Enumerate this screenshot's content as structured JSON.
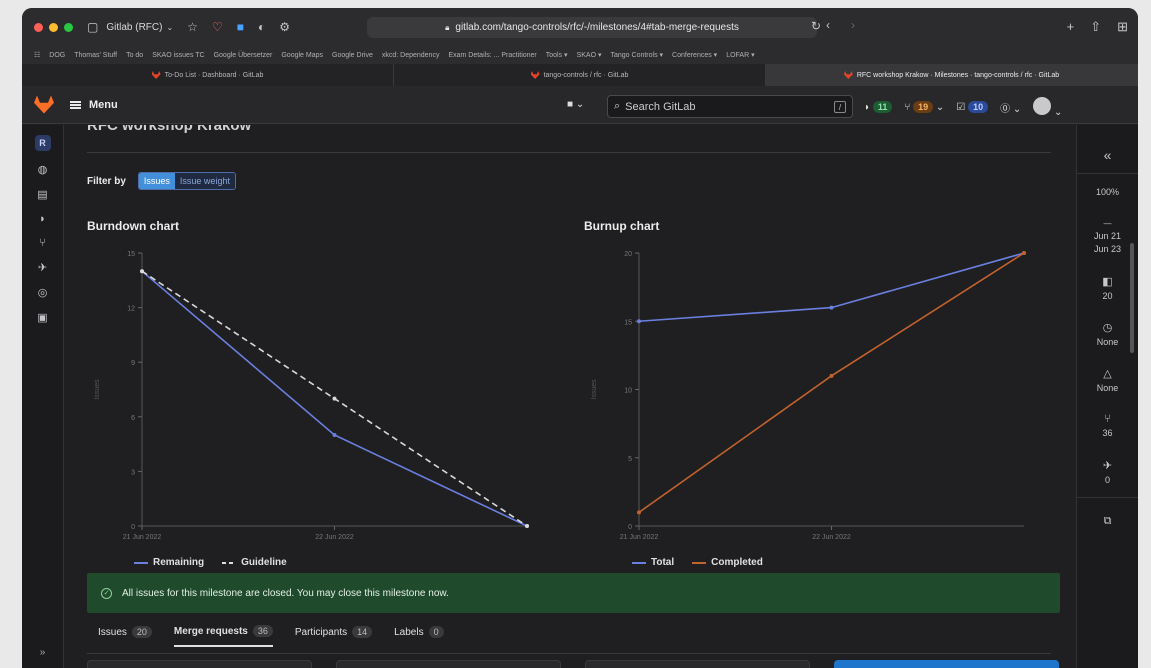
{
  "browser": {
    "tab_group": "Gitlab (RFC)",
    "url": "gitlab.com/tango-controls/rfc/-/milestones/4#tab-merge-requests",
    "bookmarks": [
      "DOG",
      "Thomas' Stuff",
      "To do",
      "SKAO issues TC",
      "Google Übersetzer",
      "Google Maps",
      "Google Drive",
      "xkcd: Dependency",
      "Exam Details: ... Practitioner",
      "Tools ▾",
      "SKAO ▾",
      "Tango Controls ▾",
      "Conferences ▾",
      "LOFAR ▾"
    ],
    "tabs": [
      {
        "label": "To-Do List · Dashboard · GitLab",
        "active": false
      },
      {
        "label": "tango-controls / rfc · GitLab",
        "active": false
      },
      {
        "label": "RFC workshop Krakow · Milestones · tango-controls / rfc · GitLab",
        "active": true
      }
    ]
  },
  "header": {
    "menu_label": "Menu",
    "search_placeholder": "Search GitLab",
    "search_shortcut": "/",
    "issues_count": "11",
    "mr_count": "19",
    "todo_count": "10"
  },
  "sidebar": {
    "project_letter": "R"
  },
  "main": {
    "title": "RFC workshop Krakow",
    "filter_label": "Filter by",
    "filter_options": [
      "Issues",
      "Issue weight"
    ],
    "burndown_title": "Burndown chart",
    "burnup_title": "Burnup chart",
    "alert": "All issues for this milestone are closed. You may close this milestone now.",
    "tabs": [
      {
        "label": "Issues",
        "count": "20"
      },
      {
        "label": "Merge requests",
        "count": "36"
      },
      {
        "label": "Participants",
        "count": "14"
      },
      {
        "label": "Labels",
        "count": "0"
      }
    ]
  },
  "right_sidebar": {
    "zoom": "100%",
    "start": "Jun 21",
    "end": "Jun 23",
    "issues": "20",
    "time": "None",
    "weight": "None",
    "mrs": "36",
    "releases": "0"
  },
  "colors": {
    "blue": "#6b7fe0",
    "orange": "#c4622d",
    "guideline": "#d9d9d9",
    "alert_bg": "#1f4a2c"
  },
  "chart_data": [
    {
      "type": "line",
      "title": "Burndown chart",
      "x": [
        "21 Jun 2022",
        "22 Jun 2022",
        "23 Jun 2022"
      ],
      "x_tick_labels": [
        "21 Jun 2022",
        "22 Jun 2022"
      ],
      "ylim": [
        0,
        15
      ],
      "yticks": [
        0,
        3,
        6,
        9,
        12,
        15
      ],
      "ylabel": "Issues",
      "series": [
        {
          "name": "Remaining",
          "values": [
            14,
            5,
            0
          ],
          "color": "#6b7fe0",
          "style": "solid"
        },
        {
          "name": "Guideline",
          "values": [
            14,
            7,
            0
          ],
          "color": "#d9d9d9",
          "style": "dashed"
        }
      ]
    },
    {
      "type": "line",
      "title": "Burnup chart",
      "x": [
        "21 Jun 2022",
        "22 Jun 2022",
        "23 Jun 2022"
      ],
      "x_tick_labels": [
        "21 Jun 2022",
        "22 Jun 2022"
      ],
      "ylim": [
        0,
        20
      ],
      "yticks": [
        0,
        5,
        10,
        15,
        20
      ],
      "ylabel": "Issues",
      "series": [
        {
          "name": "Total",
          "values": [
            15,
            16,
            20
          ],
          "color": "#6b7fe0",
          "style": "solid"
        },
        {
          "name": "Completed",
          "values": [
            1,
            11,
            20
          ],
          "color": "#c4622d",
          "style": "solid"
        }
      ]
    }
  ]
}
